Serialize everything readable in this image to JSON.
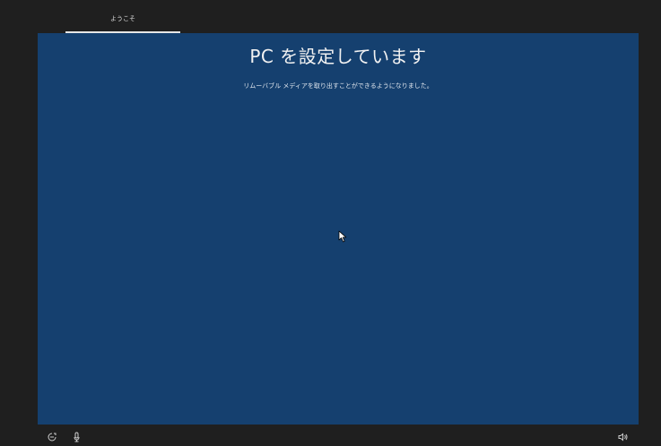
{
  "tabs": [
    {
      "label": "ようこそ",
      "selected": true
    }
  ],
  "main": {
    "title": "PC を設定しています",
    "subtitle": "リムーバブル メディアを取り出すことができるようになりました。"
  },
  "bottom_bar": {
    "left_icons": [
      "accessibility-icon",
      "microphone-icon"
    ],
    "right_icons": [
      "volume-icon"
    ]
  },
  "colors": {
    "panel_background": "#15406f",
    "frame_background": "#1f1f1f",
    "text": "#f2f2f2"
  }
}
